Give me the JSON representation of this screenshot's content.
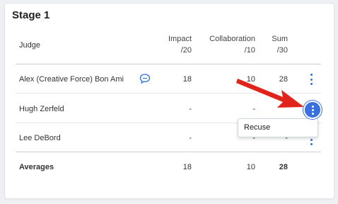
{
  "stage": {
    "title": "Stage 1"
  },
  "columns": {
    "judge": "Judge",
    "impact": "Impact",
    "impact_max": "/20",
    "collaboration": "Collaboration",
    "collaboration_max": "/10",
    "sum": "Sum",
    "sum_max": "/30"
  },
  "rows": [
    {
      "judge": "Alex (Creative Force) Bon Ami",
      "impact": "18",
      "collaboration": "10",
      "sum": "28",
      "has_comment": true
    },
    {
      "judge": "Hugh Zerfeld",
      "impact": "-",
      "collaboration": "-",
      "sum": ""
    },
    {
      "judge": "Lee DeBord",
      "impact": "-",
      "collaboration": "-",
      "sum": "-"
    }
  ],
  "averages": {
    "label": "Averages",
    "impact": "18",
    "collaboration": "10",
    "sum": "28"
  },
  "menu": {
    "items": [
      "Recuse"
    ]
  },
  "icons": {
    "comment": "comment-bubble-icon",
    "more": "vertical-dots-icon",
    "pointer": "red-arrow"
  },
  "colors": {
    "accent": "#2f6fdc",
    "arrow": "#e0231b"
  }
}
